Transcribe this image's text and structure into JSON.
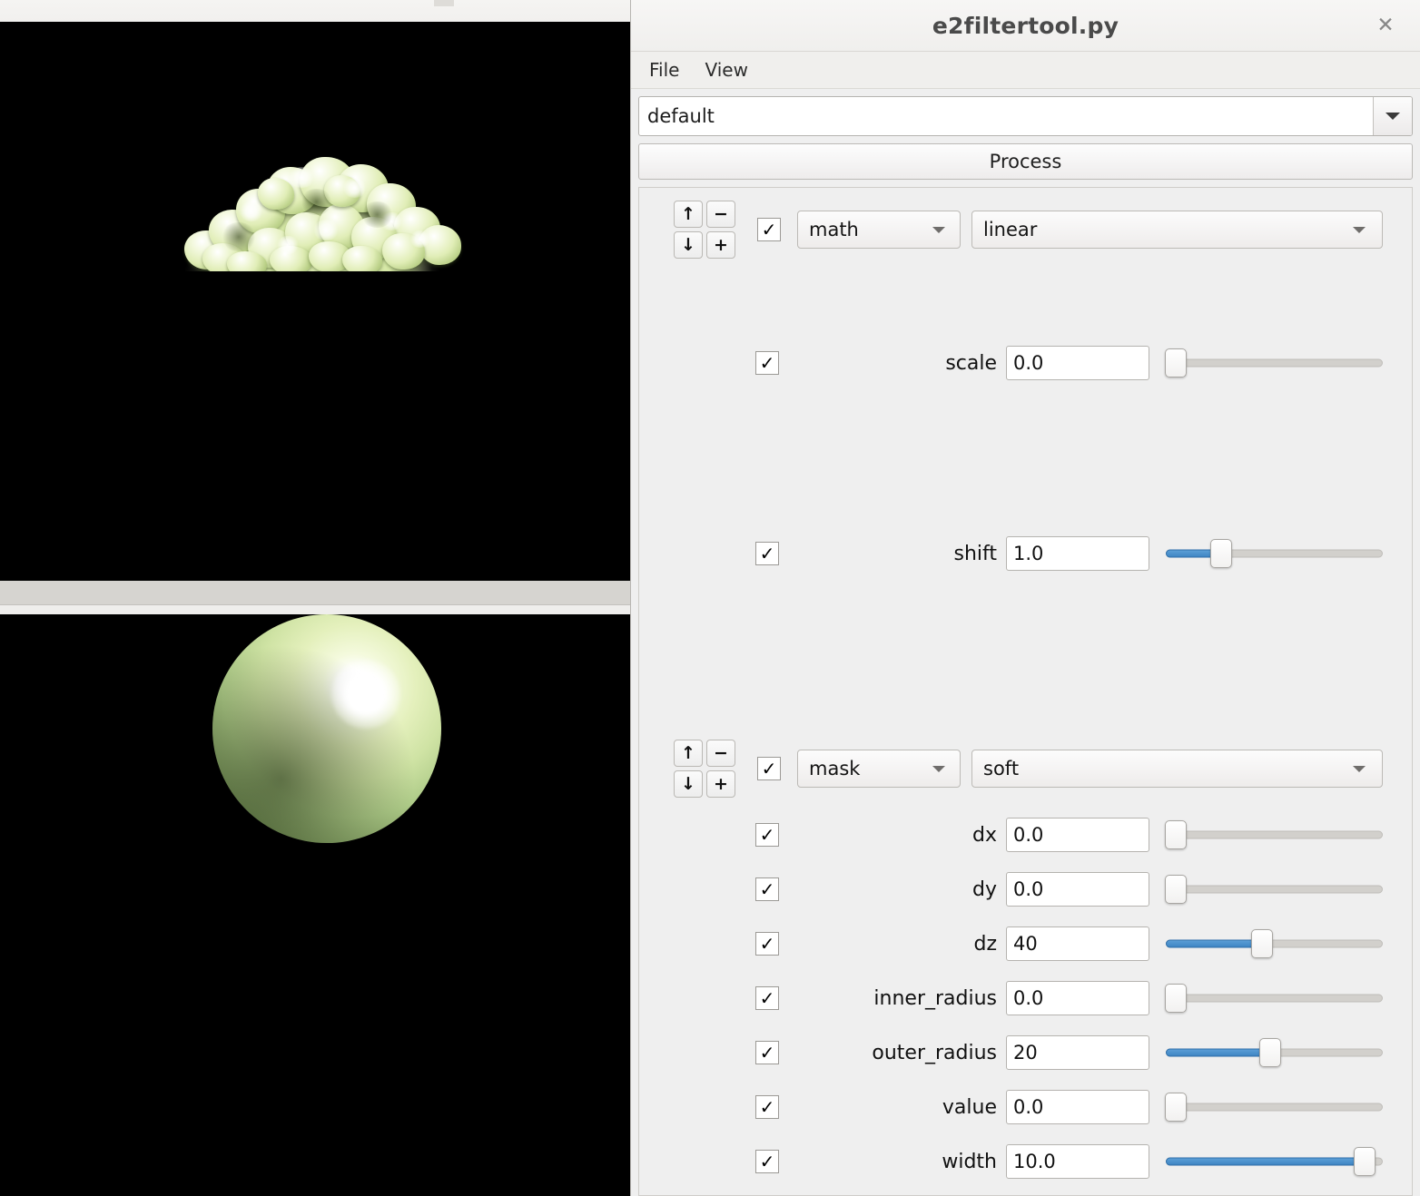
{
  "viewers": {
    "top": {
      "name": "isosurface-3d-view",
      "background": "#000000",
      "object": "noisy-blob-isosurface",
      "surface_color": "#dfeeb4"
    },
    "bottom": {
      "name": "sphere-3d-view",
      "background": "#000000",
      "object": "shaded-sphere",
      "surface_color": "#cfe3a4"
    }
  },
  "dialog": {
    "title": "e2filtertool.py",
    "close_icon": "close-icon",
    "menu": [
      "File",
      "View"
    ],
    "preset": {
      "value": "default",
      "caret_icon": "chevron-down-icon"
    },
    "process_label": "Process",
    "accent_color": "#3f86c4"
  },
  "filters": [
    {
      "enabled_mark": "✓",
      "type": "math",
      "mode": "linear",
      "pad": {
        "up": "↑",
        "minus": "−",
        "down": "↓",
        "plus": "+"
      },
      "params": [
        {
          "label": "scale",
          "value": "0.0",
          "checked": "✓",
          "slider_pct": 0
        },
        {
          "label": "shift",
          "value": "1.0",
          "checked": "✓",
          "slider_pct": 23
        }
      ]
    },
    {
      "enabled_mark": "✓",
      "type": "mask",
      "mode": "soft",
      "pad": {
        "up": "↑",
        "minus": "−",
        "down": "↓",
        "plus": "+"
      },
      "params": [
        {
          "label": "dx",
          "value": "0.0",
          "checked": "✓",
          "slider_pct": 0
        },
        {
          "label": "dy",
          "value": "0.0",
          "checked": "✓",
          "slider_pct": 0
        },
        {
          "label": "dz",
          "value": "40",
          "checked": "✓",
          "slider_pct": 44
        },
        {
          "label": "inner_radius",
          "value": "0.0",
          "checked": "✓",
          "slider_pct": 0
        },
        {
          "label": "outer_radius",
          "value": "20",
          "checked": "✓",
          "slider_pct": 48
        },
        {
          "label": "value",
          "value": "0.0",
          "checked": "✓",
          "slider_pct": 0
        },
        {
          "label": "width",
          "value": "10.0",
          "checked": "✓",
          "slider_pct": 96
        }
      ]
    }
  ]
}
